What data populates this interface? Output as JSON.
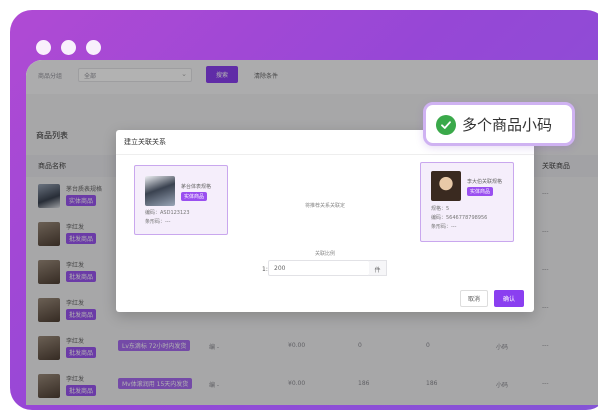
{
  "filters": {
    "category_label": "商品分组",
    "category_value": "全部",
    "search_button": "搜索",
    "clear_button": "清除条件"
  },
  "list_title": "商品列表",
  "table": {
    "col_name": "商品名称",
    "col_related": "关联商品"
  },
  "rows": [
    {
      "name": "茅台质表规格",
      "tag": "实体商品",
      "spec": "",
      "col_a": "",
      "price": "",
      "col_c": "",
      "col_d": "",
      "col_e": "",
      "col_f": "---"
    },
    {
      "name": "李红发",
      "tag": "批发商品",
      "spec": "",
      "col_a": "",
      "price": "",
      "col_c": "",
      "col_d": "",
      "col_e": "",
      "col_f": "---"
    },
    {
      "name": "李红发",
      "tag": "批发商品",
      "spec": "",
      "col_a": "",
      "price": "",
      "col_c": "",
      "col_d": "",
      "col_e": "",
      "col_f": "---"
    },
    {
      "name": "李红发",
      "tag": "批发商品",
      "spec": "",
      "col_a": "",
      "price": "",
      "col_c": "",
      "col_d": "",
      "col_e": "",
      "col_f": "---"
    },
    {
      "name": "李红发",
      "tag": "批发商品",
      "spec": "Lv东滴标 72小时内发货",
      "col_a": "编 -",
      "price": "¥0.00",
      "col_c": "0",
      "col_d": "0",
      "col_e": "小码",
      "col_f": "---"
    },
    {
      "name": "李红发",
      "tag": "批发商品",
      "spec": "Mv体滚润用 15天内发货",
      "col_a": "编 -",
      "price": "¥0.00",
      "col_c": "186",
      "col_d": "186",
      "col_e": "小码",
      "col_f": "---"
    }
  ],
  "modal": {
    "title": "建立关联关系",
    "left_card": {
      "name": "茅台体表规格",
      "tag": "实体商品",
      "code": "编码：ASD123123",
      "extra": "条形码：---"
    },
    "right_card": {
      "name": "李大伯关联规格",
      "tag": "实体商品",
      "ratio": "规格：5",
      "code": "编码：5646778798956",
      "extra": "条形码：---"
    },
    "center_hint": "将推荐关系关联定",
    "ratio_label": "关联比例",
    "ratio_prefix": "1:",
    "ratio_value": "200",
    "ratio_unit": "件",
    "cancel": "取消",
    "confirm": "确认"
  },
  "badge": {
    "icon": "check-circle-icon",
    "text": "多个商品小码",
    "color": "#3aa94a"
  }
}
